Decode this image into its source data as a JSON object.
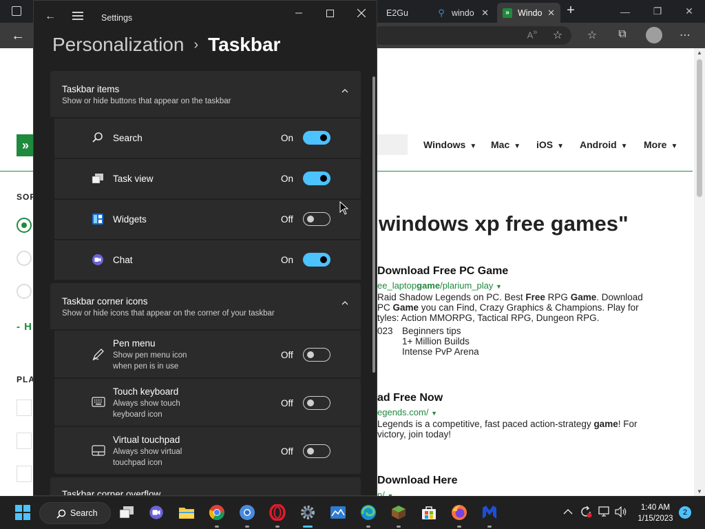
{
  "browser": {
    "tabs": [
      {
        "label": "E2Gu",
        "active": false
      },
      {
        "label": "windo",
        "active": false
      },
      {
        "label": "Windo",
        "active": true
      }
    ],
    "nav": [
      {
        "label": "Windows"
      },
      {
        "label": "Mac"
      },
      {
        "label": "iOS"
      },
      {
        "label": "Android"
      },
      {
        "label": "More"
      }
    ],
    "left_labels": {
      "sort": "SOR",
      "h": "- H",
      "platform": "PLA"
    },
    "serp_title": "windows xp free games\"",
    "ads": [
      {
        "head": "Download Free PC Game",
        "url_parts": [
          "ee_laptop",
          "game",
          "/plarium_play"
        ],
        "line1": [
          "Raid Shadow Legends on PC. Best ",
          "Free",
          " RPG ",
          "Game",
          ". Download"
        ],
        "line2": [
          " PC ",
          "Game",
          " you can Find, Crazy Graphics & Champions. Play for"
        ],
        "line3": "tyles: Action MMORPG, Tactical RPG, Dungeon RPG.",
        "date": "023",
        "sitelinks": [
          "Beginners tips",
          "1+ Million Builds",
          "Intense PvP Arena"
        ]
      },
      {
        "head": "ad Free Now",
        "url": "egends.com/",
        "line1": [
          "Legends is a competitive, fast paced action-strategy ",
          "game",
          "! For"
        ],
        "line2": "victory, join today!"
      },
      {
        "head": "Download Here",
        "url": "n/"
      }
    ]
  },
  "settings": {
    "window_title": "Settings",
    "breadcrumb": {
      "parent": "Personalization",
      "separator": "›",
      "current": "Taskbar"
    },
    "groups": [
      {
        "title": "Taskbar items",
        "subtitle": "Show or hide buttons that appear on the taskbar",
        "items": [
          {
            "label": "Search",
            "state": "On",
            "on": true,
            "icon": "search-icon"
          },
          {
            "label": "Task view",
            "state": "On",
            "on": true,
            "icon": "task-view-icon"
          },
          {
            "label": "Widgets",
            "state": "Off",
            "on": false,
            "icon": "widgets-icon"
          },
          {
            "label": "Chat",
            "state": "On",
            "on": true,
            "icon": "chat-icon"
          }
        ]
      },
      {
        "title": "Taskbar corner icons",
        "subtitle": "Show or hide icons that appear on the corner of your taskbar",
        "items": [
          {
            "label": "Pen menu",
            "desc1": "Show pen menu icon",
            "desc2": "when pen is in use",
            "state": "Off",
            "on": false,
            "icon": "pen-icon"
          },
          {
            "label": "Touch keyboard",
            "desc1": "Always show touch",
            "desc2": "keyboard icon",
            "state": "Off",
            "on": false,
            "icon": "keyboard-icon"
          },
          {
            "label": "Virtual touchpad",
            "desc1": "Always show virtual",
            "desc2": "touchpad icon",
            "state": "Off",
            "on": false,
            "icon": "touchpad-icon"
          }
        ]
      },
      {
        "title": "Taskbar corner overflow"
      }
    ]
  },
  "taskbar": {
    "search_label": "Search",
    "time": "1:40 AM",
    "date": "1/15/2023",
    "notification_count": "2"
  },
  "colors": {
    "accent": "#4cc2ff",
    "site_green": "#1e8a3d",
    "window_bg": "#202020",
    "card_bg": "#2b2b2b"
  }
}
